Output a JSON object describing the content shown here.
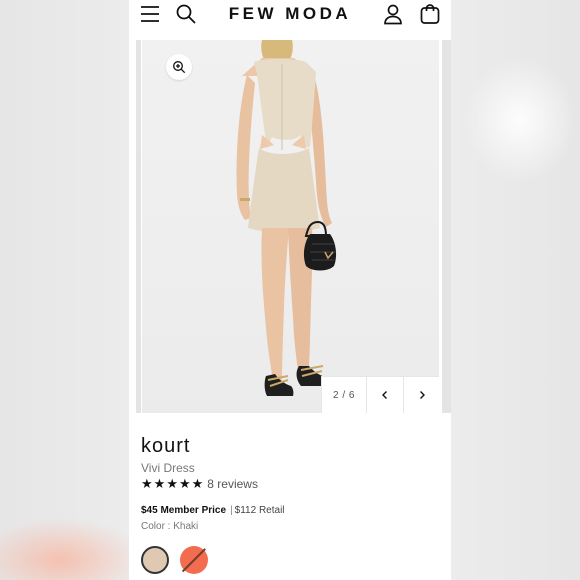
{
  "header": {
    "brand": "FEW MODA",
    "icons": [
      "menu-icon",
      "search-icon",
      "account-icon",
      "bag-icon"
    ]
  },
  "gallery": {
    "counter": "2 / 6",
    "image_alt": "Model wearing khaki sleeveless mini dress with side cutouts, holding black woven bag",
    "controls": [
      "zoom-icon",
      "chevron-left-icon",
      "chevron-right-icon"
    ]
  },
  "product": {
    "brand": "kourt",
    "name": "Vivi Dress",
    "stars": 5,
    "reviews_text": "8 reviews",
    "member_price": "$45 Member Price",
    "retail_separator": "|",
    "retail_price": "$112 Retail",
    "color_line": "Color : Khaki"
  },
  "swatches": [
    {
      "name": "Khaki",
      "color": "#e1c8b2",
      "selected": true
    },
    {
      "name": "Coral",
      "color": "#f26d4f",
      "selected": false,
      "unavailable": true
    }
  ],
  "colors": {
    "text_primary": "#111111",
    "text_secondary": "#777777",
    "background": "#ffffff"
  }
}
